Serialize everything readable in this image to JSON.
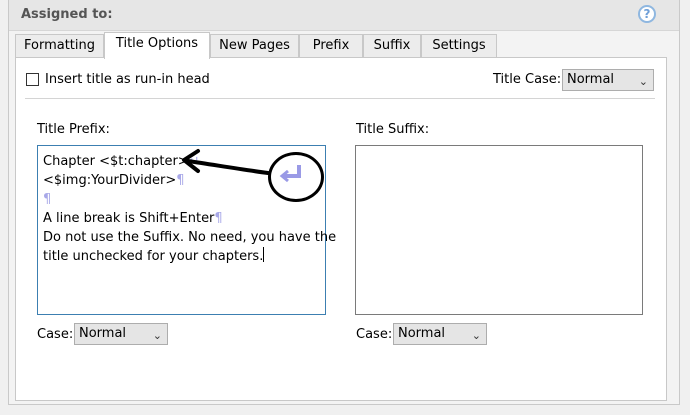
{
  "header": {
    "title": "Assigned to:",
    "help_icon": "?"
  },
  "tabs": [
    {
      "label": "Formatting"
    },
    {
      "label": "Title Options",
      "active": true
    },
    {
      "label": "New Pages"
    },
    {
      "label": "Prefix"
    },
    {
      "label": "Suffix"
    },
    {
      "label": "Settings"
    }
  ],
  "options": {
    "run_in_label": "Insert title as run-in head",
    "run_in_checked": false,
    "title_case_label": "Title Case:",
    "title_case_value": "Normal"
  },
  "prefix": {
    "label": "Title Prefix:",
    "lines": [
      {
        "text": "Chapter <$t:chapter>",
        "mark": "↵"
      },
      {
        "text": "<$img:YourDivider>",
        "mark": "¶"
      },
      {
        "text": "",
        "mark": "¶"
      },
      {
        "text": "A line break is Shift+Enter",
        "mark": "¶"
      },
      {
        "text": "Do not use the Suffix. No need, you have the",
        "mark": ""
      },
      {
        "text": "title unchecked for your chapters.",
        "mark": ""
      }
    ],
    "case_label": "Case:",
    "case_value": "Normal"
  },
  "suffix": {
    "label": "Title Suffix:",
    "case_label": "Case:",
    "case_value": "Normal"
  },
  "annotation": {
    "return_glyph": "↵"
  },
  "colors": {
    "pilcrow": "#a8a8e8",
    "focus_border": "#3c7fb1"
  }
}
